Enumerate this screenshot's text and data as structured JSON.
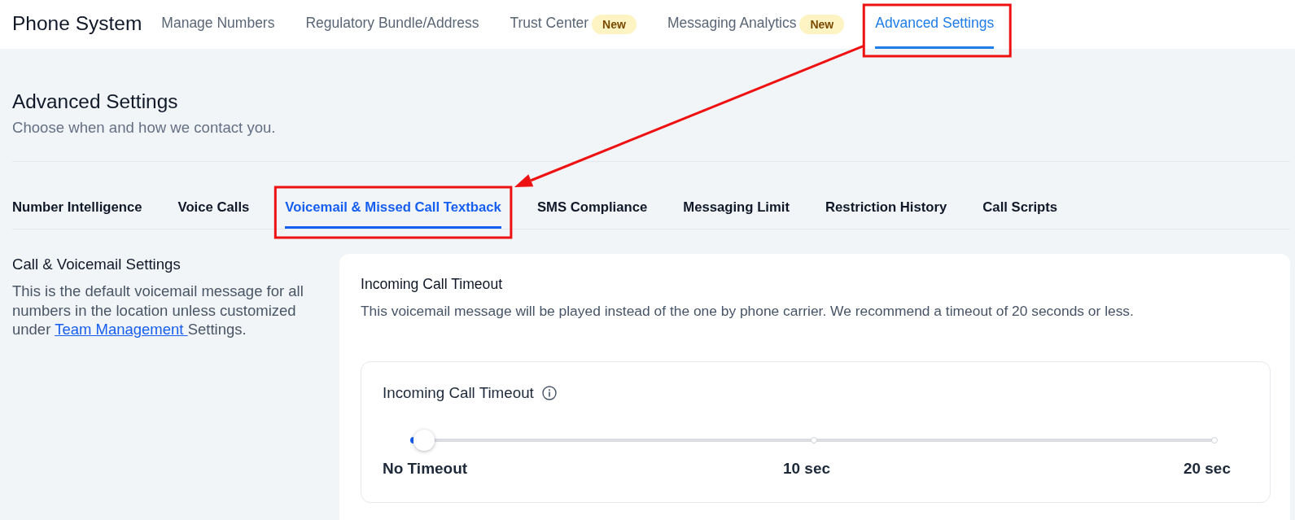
{
  "header": {
    "title": "Phone System",
    "nav": [
      {
        "label": "Manage Numbers",
        "selected": false,
        "highlighted": false
      },
      {
        "label": "Regulatory Bundle/Address",
        "selected": false,
        "highlighted": false
      },
      {
        "label": "Trust Center",
        "badge": "New",
        "selected": false,
        "highlighted": false
      },
      {
        "label": "Messaging Analytics",
        "badge": "New",
        "selected": false,
        "highlighted": false
      },
      {
        "label": "Advanced Settings",
        "selected": true,
        "highlighted": true
      }
    ]
  },
  "page": {
    "title": "Advanced Settings",
    "subtitle": "Choose when and how we contact you."
  },
  "tabs": [
    {
      "label": "Number Intelligence",
      "selected": false,
      "highlighted": false
    },
    {
      "label": "Voice Calls",
      "selected": false,
      "highlighted": false
    },
    {
      "label": "Voicemail & Missed Call Textback",
      "selected": true,
      "highlighted": true
    },
    {
      "label": "SMS Compliance",
      "selected": false,
      "highlighted": false
    },
    {
      "label": "Messaging Limit",
      "selected": false,
      "highlighted": false
    },
    {
      "label": "Restriction History",
      "selected": false,
      "highlighted": false
    },
    {
      "label": "Call Scripts",
      "selected": false,
      "highlighted": false
    }
  ],
  "section": {
    "title": "Call & Voicemail Settings",
    "description_before": "This is the default voicemail message for all numbers in the location unless customized under ",
    "link": "Team Management ",
    "description_after": "Settings."
  },
  "card": {
    "title": "Incoming Call Timeout",
    "description": "This voicemail message will be played instead of the one by phone carrier. We recommend a timeout of 20 seconds or less.",
    "setting": {
      "label": "Incoming Call Timeout",
      "level": 0,
      "stops": [
        "No Timeout",
        "10 sec",
        "20 sec"
      ]
    }
  },
  "annotation_arrow": true
}
